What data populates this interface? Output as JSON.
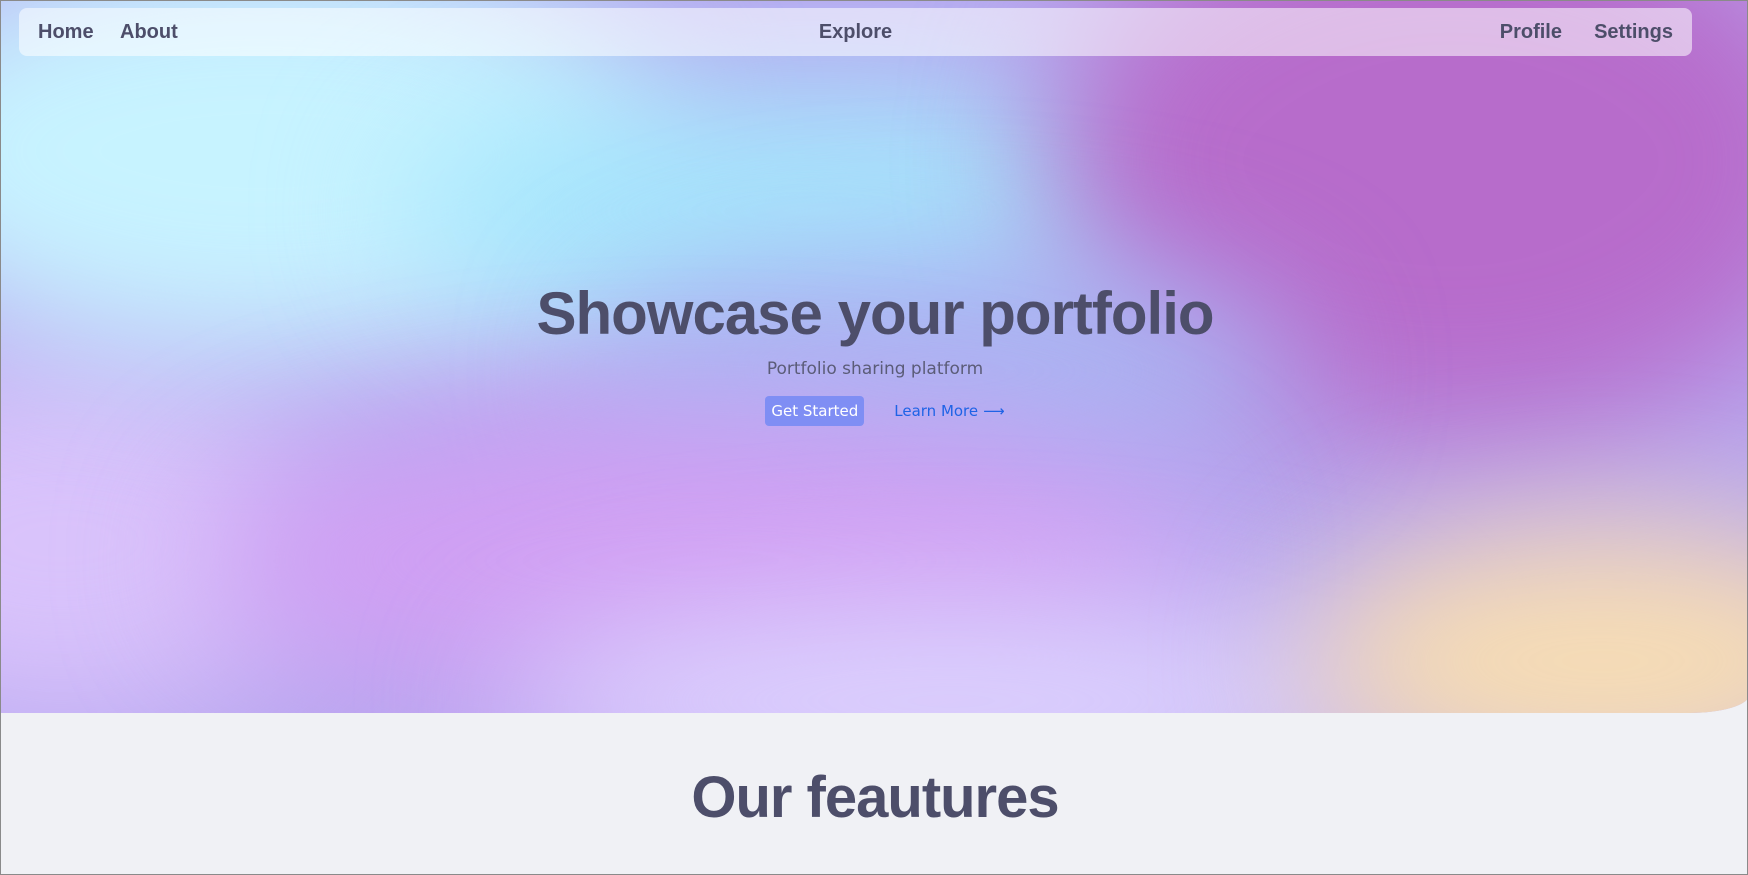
{
  "nav": {
    "home": "Home",
    "about": "About",
    "explore": "Explore",
    "profile": "Profile",
    "settings": "Settings"
  },
  "hero": {
    "title": "Showcase your portfolio",
    "subtitle": "Portfolio sharing platform",
    "primary_button": "Get Started",
    "secondary_link": "Learn More",
    "secondary_icon": "arrow-right-icon"
  },
  "features": {
    "title": "Our feautures"
  },
  "colors": {
    "text": "#4d4e6a",
    "primary_button": "#7f8ef4",
    "link": "#1f63e6",
    "page_background": "#f0f1f5"
  }
}
